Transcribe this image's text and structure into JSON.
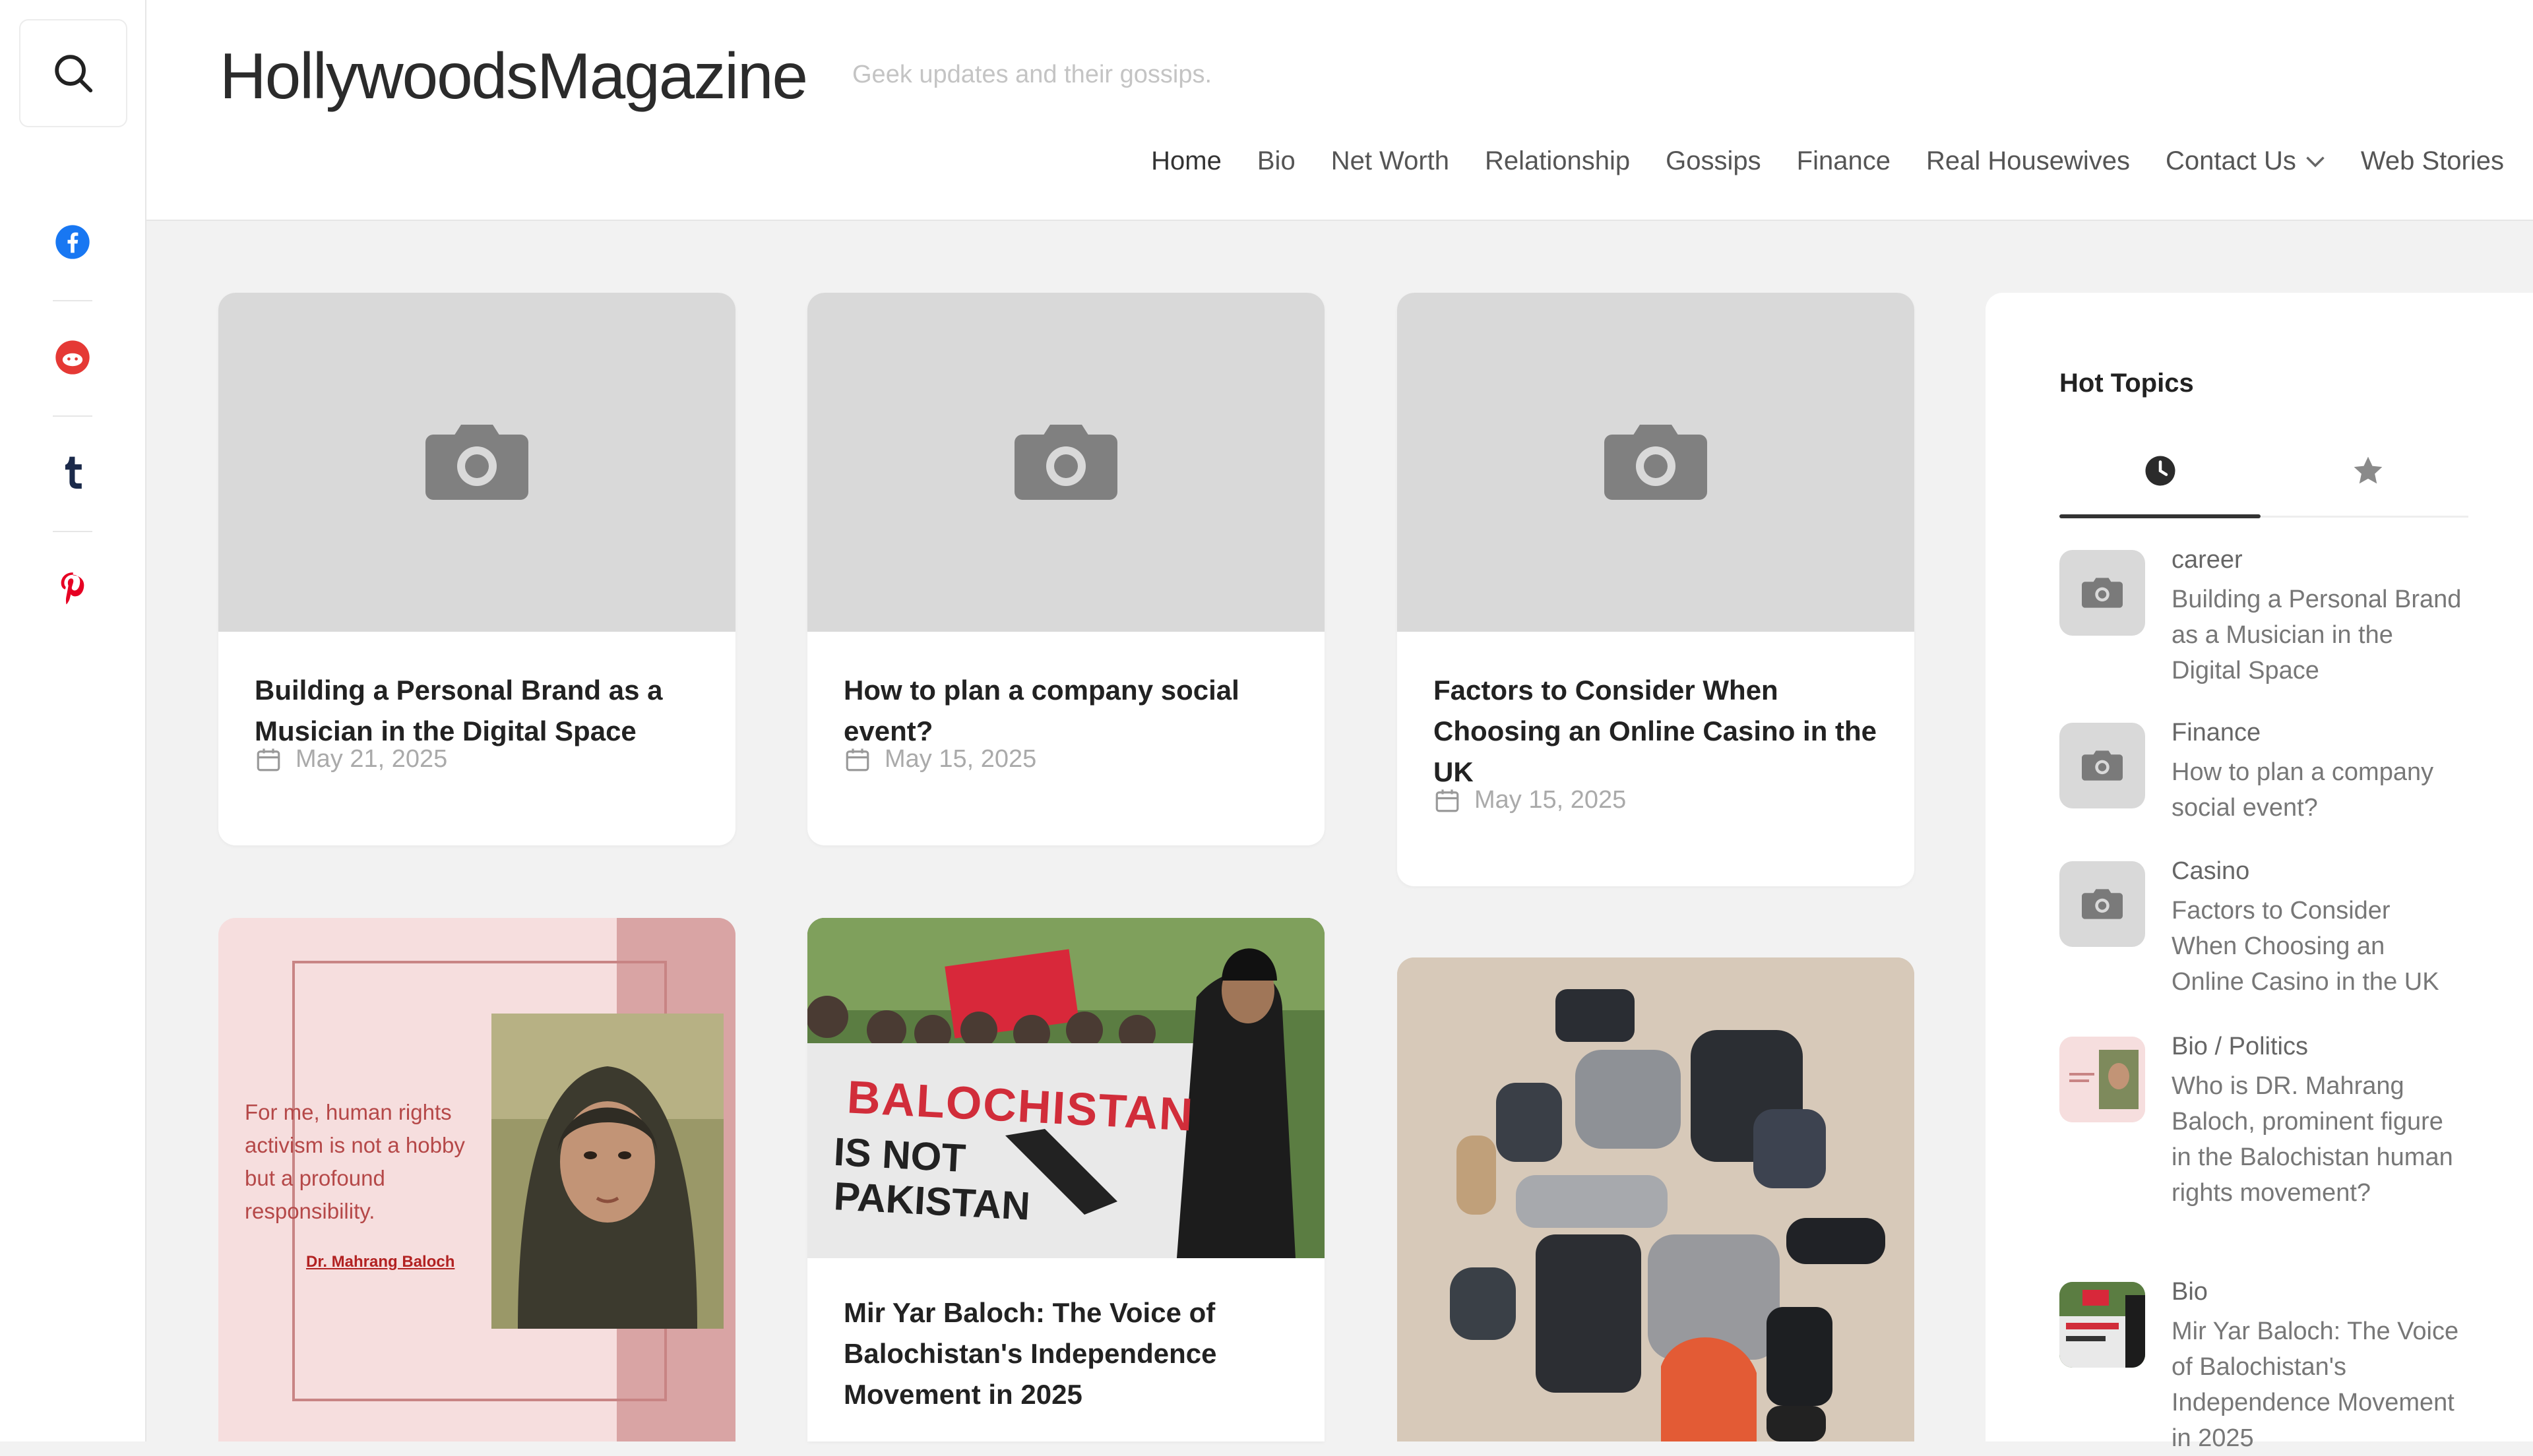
{
  "social": {
    "icons": [
      "search-icon",
      "facebook-icon",
      "reddit-icon",
      "tumblr-icon",
      "pinterest-icon"
    ],
    "colors": {
      "facebook": "#1877f2",
      "reddit": "#e53935",
      "tumblr": "#1b2a4a",
      "pinterest": "#e60023"
    }
  },
  "header": {
    "logo": "HollywoodsMagazine",
    "tagline": "Geek updates and their gossips.",
    "nav": [
      "Home",
      "Bio",
      "Net Worth",
      "Relationship",
      "Gossips",
      "Finance",
      "Real Housewives",
      "Contact Us",
      "Web Stories"
    ]
  },
  "posts": [
    {
      "title": "Building a Personal Brand as a Musician in the Digital Space",
      "date": "May 21, 2025"
    },
    {
      "title": "How to plan a company social event?",
      "date": "May 15, 2025"
    },
    {
      "title": "Factors to Consider When Choosing an Online Casino in the UK",
      "date": "May 15, 2025"
    },
    {
      "title": "Mir Yar Baloch: The Voice of Balochistan's Independence Movement in 2025"
    }
  ],
  "image_cards": {
    "quote_card": {
      "quote": "For me, human rights activism is not a hobby but a profound responsibility.",
      "signature": "Dr. Mahrang Baloch"
    },
    "protest_card": {
      "banner_line1": "BALOCHISTAN",
      "banner_line2": "IS NOT",
      "banner_line3": "PAKISTAN"
    }
  },
  "sidebar": {
    "title": "Hot Topics",
    "tabs": [
      "clock-icon",
      "star-icon"
    ],
    "topics": [
      {
        "category": "career",
        "title": "Building a Personal Brand as a Musician in the Digital Space"
      },
      {
        "category": "Finance",
        "title": "How to plan a company social event?"
      },
      {
        "category": "Casino",
        "title": "Factors to Consider When Choosing an Online Casino in the UK"
      },
      {
        "category": "Bio / Politics",
        "title": "Who is DR. Mahrang Baloch, prominent figure in the Balochistan human rights movement?"
      },
      {
        "category": "Bio",
        "title": "Mir Yar Baloch: The Voice of Balochistan's Independence Movement in 2025"
      }
    ]
  }
}
